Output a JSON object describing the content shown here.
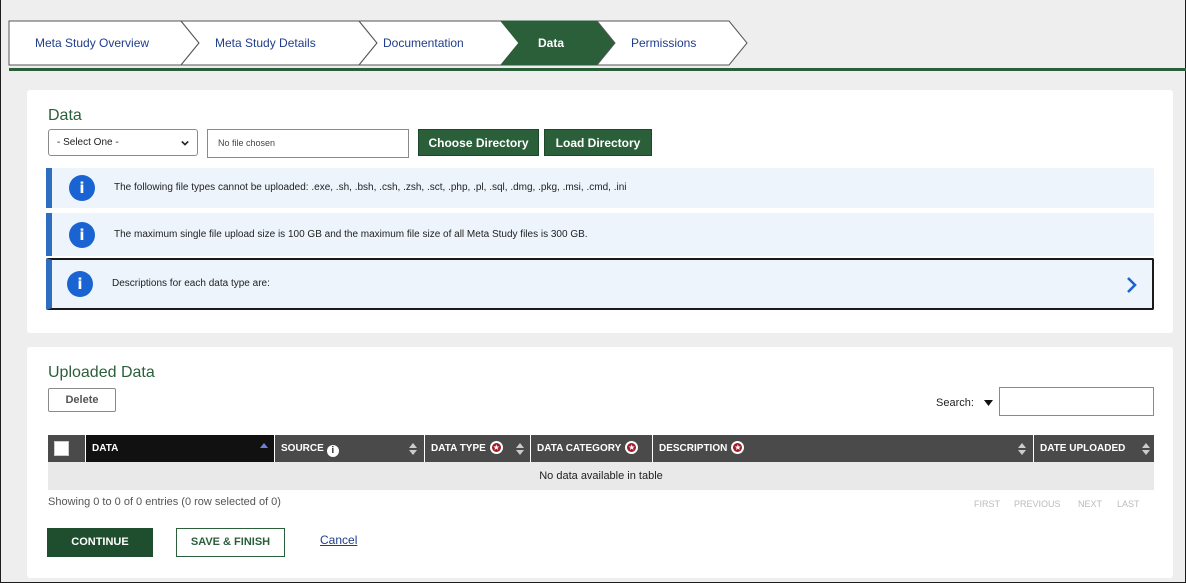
{
  "stepper": {
    "steps": [
      {
        "label": "Meta Study Overview",
        "active": false
      },
      {
        "label": "Meta Study Details",
        "active": false
      },
      {
        "label": "Documentation",
        "active": false
      },
      {
        "label": "Data",
        "active": true
      },
      {
        "label": "Permissions",
        "active": false
      }
    ],
    "active_color": "#2b5f3a"
  },
  "data_panel": {
    "title": "Data",
    "select_value": "- Select One -",
    "file_input_text": "No file chosen",
    "choose_directory_label": "Choose Directory",
    "load_directory_label": "Load Directory",
    "alerts": [
      {
        "icon": "info-icon",
        "text": "The following file types cannot be uploaded: .exe, .sh, .bsh, .csh, .zsh, .sct, .php, .pl, .sql, .dmg, .pkg, .msi, .cmd, .ini"
      },
      {
        "icon": "info-icon",
        "text": "The maximum single file upload size is 100 GB and the maximum file size of all Meta Study files is 300 GB."
      },
      {
        "icon": "info-icon",
        "text": "Descriptions for each data type are:",
        "expand_icon": "chevron-right-icon"
      }
    ]
  },
  "uploaded_panel": {
    "title": "Uploaded Data",
    "delete_label": "Delete",
    "search_label": "Search:",
    "search_value": "",
    "columns": [
      {
        "label": "DATA",
        "sort": "asc"
      },
      {
        "label": "SOURCE",
        "icon": "info-icon",
        "sort": "both"
      },
      {
        "label": "DATA TYPE",
        "required": true,
        "sort": "both"
      },
      {
        "label": "DATA CATEGORY",
        "required": true
      },
      {
        "label": "DESCRIPTION",
        "required": true,
        "sort": "both"
      },
      {
        "label": "DATE UPLOADED",
        "sort": "both"
      }
    ],
    "empty_message": "No data available in table",
    "info_text": "Showing 0 to 0 of 0 entries (0 row selected of 0)",
    "pager": [
      "FIRST",
      "PREVIOUS",
      "NEXT",
      "LAST"
    ]
  },
  "actions": {
    "continue_label": "CONTINUE",
    "save_finish_label": "SAVE & FINISH",
    "cancel_label": "Cancel"
  }
}
